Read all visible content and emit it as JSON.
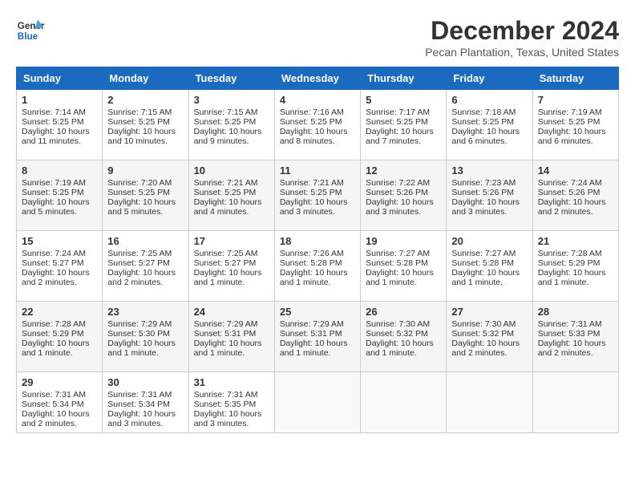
{
  "logo": {
    "line1": "General",
    "line2": "Blue"
  },
  "title": "December 2024",
  "location": "Pecan Plantation, Texas, United States",
  "headers": [
    "Sunday",
    "Monday",
    "Tuesday",
    "Wednesday",
    "Thursday",
    "Friday",
    "Saturday"
  ],
  "weeks": [
    [
      {
        "day": "1",
        "sunrise": "7:14 AM",
        "sunset": "5:25 PM",
        "daylight": "10 hours and 11 minutes."
      },
      {
        "day": "2",
        "sunrise": "7:15 AM",
        "sunset": "5:25 PM",
        "daylight": "10 hours and 10 minutes."
      },
      {
        "day": "3",
        "sunrise": "7:15 AM",
        "sunset": "5:25 PM",
        "daylight": "10 hours and 9 minutes."
      },
      {
        "day": "4",
        "sunrise": "7:16 AM",
        "sunset": "5:25 PM",
        "daylight": "10 hours and 8 minutes."
      },
      {
        "day": "5",
        "sunrise": "7:17 AM",
        "sunset": "5:25 PM",
        "daylight": "10 hours and 7 minutes."
      },
      {
        "day": "6",
        "sunrise": "7:18 AM",
        "sunset": "5:25 PM",
        "daylight": "10 hours and 6 minutes."
      },
      {
        "day": "7",
        "sunrise": "7:19 AM",
        "sunset": "5:25 PM",
        "daylight": "10 hours and 6 minutes."
      }
    ],
    [
      {
        "day": "8",
        "sunrise": "7:19 AM",
        "sunset": "5:25 PM",
        "daylight": "10 hours and 5 minutes."
      },
      {
        "day": "9",
        "sunrise": "7:20 AM",
        "sunset": "5:25 PM",
        "daylight": "10 hours and 5 minutes."
      },
      {
        "day": "10",
        "sunrise": "7:21 AM",
        "sunset": "5:25 PM",
        "daylight": "10 hours and 4 minutes."
      },
      {
        "day": "11",
        "sunrise": "7:21 AM",
        "sunset": "5:25 PM",
        "daylight": "10 hours and 3 minutes."
      },
      {
        "day": "12",
        "sunrise": "7:22 AM",
        "sunset": "5:26 PM",
        "daylight": "10 hours and 3 minutes."
      },
      {
        "day": "13",
        "sunrise": "7:23 AM",
        "sunset": "5:26 PM",
        "daylight": "10 hours and 3 minutes."
      },
      {
        "day": "14",
        "sunrise": "7:24 AM",
        "sunset": "5:26 PM",
        "daylight": "10 hours and 2 minutes."
      }
    ],
    [
      {
        "day": "15",
        "sunrise": "7:24 AM",
        "sunset": "5:27 PM",
        "daylight": "10 hours and 2 minutes."
      },
      {
        "day": "16",
        "sunrise": "7:25 AM",
        "sunset": "5:27 PM",
        "daylight": "10 hours and 2 minutes."
      },
      {
        "day": "17",
        "sunrise": "7:25 AM",
        "sunset": "5:27 PM",
        "daylight": "10 hours and 1 minute."
      },
      {
        "day": "18",
        "sunrise": "7:26 AM",
        "sunset": "5:28 PM",
        "daylight": "10 hours and 1 minute."
      },
      {
        "day": "19",
        "sunrise": "7:27 AM",
        "sunset": "5:28 PM",
        "daylight": "10 hours and 1 minute."
      },
      {
        "day": "20",
        "sunrise": "7:27 AM",
        "sunset": "5:28 PM",
        "daylight": "10 hours and 1 minute."
      },
      {
        "day": "21",
        "sunrise": "7:28 AM",
        "sunset": "5:29 PM",
        "daylight": "10 hours and 1 minute."
      }
    ],
    [
      {
        "day": "22",
        "sunrise": "7:28 AM",
        "sunset": "5:29 PM",
        "daylight": "10 hours and 1 minute."
      },
      {
        "day": "23",
        "sunrise": "7:29 AM",
        "sunset": "5:30 PM",
        "daylight": "10 hours and 1 minute."
      },
      {
        "day": "24",
        "sunrise": "7:29 AM",
        "sunset": "5:31 PM",
        "daylight": "10 hours and 1 minute."
      },
      {
        "day": "25",
        "sunrise": "7:29 AM",
        "sunset": "5:31 PM",
        "daylight": "10 hours and 1 minute."
      },
      {
        "day": "26",
        "sunrise": "7:30 AM",
        "sunset": "5:32 PM",
        "daylight": "10 hours and 1 minute."
      },
      {
        "day": "27",
        "sunrise": "7:30 AM",
        "sunset": "5:32 PM",
        "daylight": "10 hours and 2 minutes."
      },
      {
        "day": "28",
        "sunrise": "7:31 AM",
        "sunset": "5:33 PM",
        "daylight": "10 hours and 2 minutes."
      }
    ],
    [
      {
        "day": "29",
        "sunrise": "7:31 AM",
        "sunset": "5:34 PM",
        "daylight": "10 hours and 2 minutes."
      },
      {
        "day": "30",
        "sunrise": "7:31 AM",
        "sunset": "5:34 PM",
        "daylight": "10 hours and 3 minutes."
      },
      {
        "day": "31",
        "sunrise": "7:31 AM",
        "sunset": "5:35 PM",
        "daylight": "10 hours and 3 minutes."
      },
      null,
      null,
      null,
      null
    ]
  ],
  "labels": {
    "sunrise": "Sunrise:",
    "sunset": "Sunset:",
    "daylight": "Daylight:"
  }
}
